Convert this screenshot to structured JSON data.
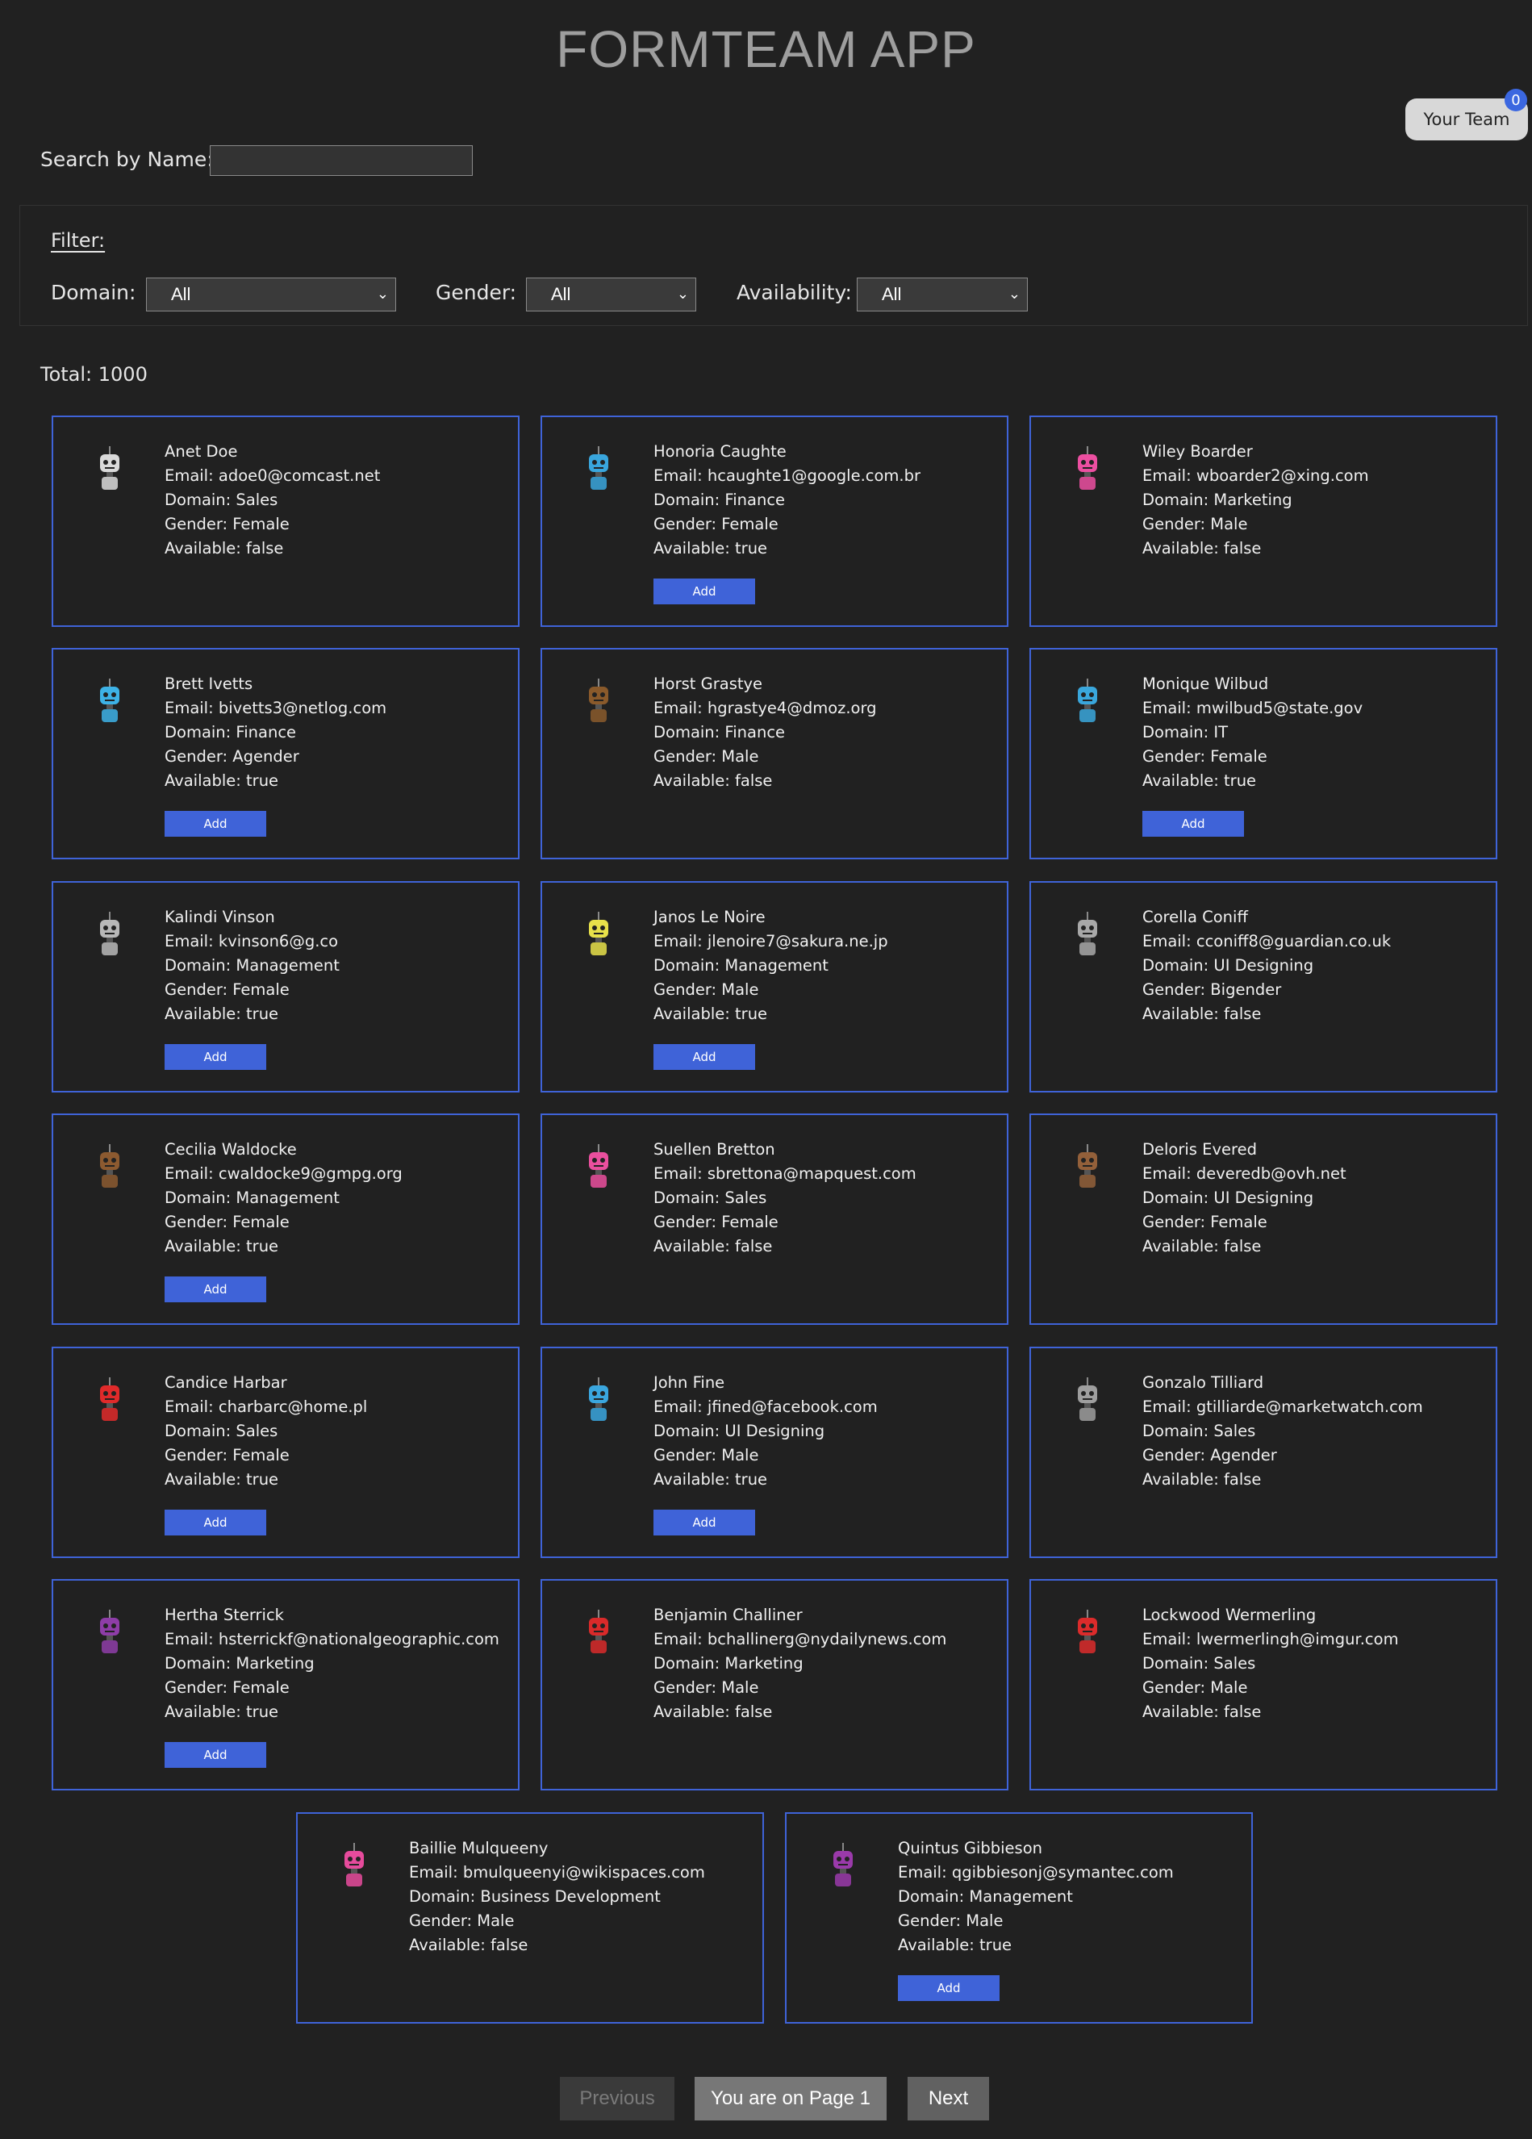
{
  "app_title": "FORMTEAM APP",
  "team": {
    "label": "Your Team",
    "count": "0"
  },
  "search": {
    "label": "Search by Name:",
    "value": ""
  },
  "filter": {
    "title": "Filter:",
    "domain": {
      "label": "Domain:",
      "value": "All"
    },
    "gender": {
      "label": "Gender:",
      "value": "All"
    },
    "availability": {
      "label": "Availability:",
      "value": "All"
    }
  },
  "total": "Total: 1000",
  "add_label": "Add",
  "users": [
    {
      "name": "Anet Doe",
      "email": "Email: adoe0@comcast.net",
      "domain": "Domain: Sales",
      "gender": "Gender: Female",
      "available": "Available: false",
      "color": "#d9d9d9"
    },
    {
      "name": "Honoria Caughte",
      "email": "Email: hcaughte1@google.com.br",
      "domain": "Domain: Finance",
      "gender": "Gender: Female",
      "available": "Available: true",
      "color": "#39a6dd"
    },
    {
      "name": "Wiley Boarder",
      "email": "Email: wboarder2@xing.com",
      "domain": "Domain: Marketing",
      "gender": "Gender: Male",
      "available": "Available: false",
      "color": "#ec4fa1"
    },
    {
      "name": "Brett Ivetts",
      "email": "Email: bivetts3@netlog.com",
      "domain": "Domain: Finance",
      "gender": "Gender: Agender",
      "available": "Available: true",
      "color": "#3db2e6"
    },
    {
      "name": "Horst Grastye",
      "email": "Email: hgrastye4@dmoz.org",
      "domain": "Domain: Finance",
      "gender": "Gender: Male",
      "available": "Available: false",
      "color": "#8a5a2b"
    },
    {
      "name": "Monique Wilbud",
      "email": "Email: mwilbud5@state.gov",
      "domain": "Domain: IT",
      "gender": "Gender: Female",
      "available": "Available: true",
      "color": "#3aa7dc"
    },
    {
      "name": "Kalindi Vinson",
      "email": "Email: kvinson6@g.co",
      "domain": "Domain: Management",
      "gender": "Gender: Female",
      "available": "Available: true",
      "color": "#b8b8b8"
    },
    {
      "name": "Janos Le Noire",
      "email": "Email: jlenoire7@sakura.ne.jp",
      "domain": "Domain: Management",
      "gender": "Gender: Male",
      "available": "Available: true",
      "color": "#e8e14a"
    },
    {
      "name": "Corella Coniff",
      "email": "Email: cconiff8@guardian.co.uk",
      "domain": "Domain: UI Designing",
      "gender": "Gender: Bigender",
      "available": "Available: false",
      "color": "#a8a8a8"
    },
    {
      "name": "Cecilia Waldocke",
      "email": "Email: cwaldocke9@gmpg.org",
      "domain": "Domain: Management",
      "gender": "Gender: Female",
      "available": "Available: true",
      "color": "#8c5a30"
    },
    {
      "name": "Suellen Bretton",
      "email": "Email: sbrettona@mapquest.com",
      "domain": "Domain: Sales",
      "gender": "Gender: Female",
      "available": "Available: false",
      "color": "#ea4f9e"
    },
    {
      "name": "Deloris Evered",
      "email": "Email: deveredb@ovh.net",
      "domain": "Domain: UI Designing",
      "gender": "Gender: Female",
      "available": "Available: false",
      "color": "#93603a"
    },
    {
      "name": "Candice Harbar",
      "email": "Email: charbarc@home.pl",
      "domain": "Domain: Sales",
      "gender": "Gender: Female",
      "available": "Available: true",
      "color": "#e02a2a"
    },
    {
      "name": "John Fine",
      "email": "Email: jfined@facebook.com",
      "domain": "Domain: UI Designing",
      "gender": "Gender: Male",
      "available": "Available: true",
      "color": "#3aa6de"
    },
    {
      "name": "Gonzalo Tilliard",
      "email": "Email: gtilliarde@marketwatch.com",
      "domain": "Domain: Sales",
      "gender": "Gender: Agender",
      "available": "Available: false",
      "color": "#9e9e9e"
    },
    {
      "name": "Hertha Sterrick",
      "email": "Email: hsterrickf@nationalgeographic.com",
      "domain": "Domain: Marketing",
      "gender": "Gender: Female",
      "available": "Available: true",
      "color": "#8e3da8"
    },
    {
      "name": "Benjamin Challiner",
      "email": "Email: bchallinerg@nydailynews.com",
      "domain": "Domain: Marketing",
      "gender": "Gender: Male",
      "available": "Available: false",
      "color": "#d92a2a"
    },
    {
      "name": "Lockwood Wermerling",
      "email": "Email: lwermerlingh@imgur.com",
      "domain": "Domain: Sales",
      "gender": "Gender: Male",
      "available": "Available: false",
      "color": "#dc2b2b"
    },
    {
      "name": "Baillie Mulqueeny",
      "email": "Email: bmulqueenyi@wikispaces.com",
      "domain": "Domain: Business Development",
      "gender": "Gender: Male",
      "available": "Available: false",
      "color": "#e64b9c"
    },
    {
      "name": "Quintus Gibbieson",
      "email": "Email: qgibbiesonj@symantec.com",
      "domain": "Domain: Management",
      "gender": "Gender: Male",
      "available": "Available: true",
      "color": "#9a3aaa"
    }
  ],
  "pagination": {
    "previous": "Previous",
    "current": "You are on Page 1",
    "next": "Next"
  }
}
